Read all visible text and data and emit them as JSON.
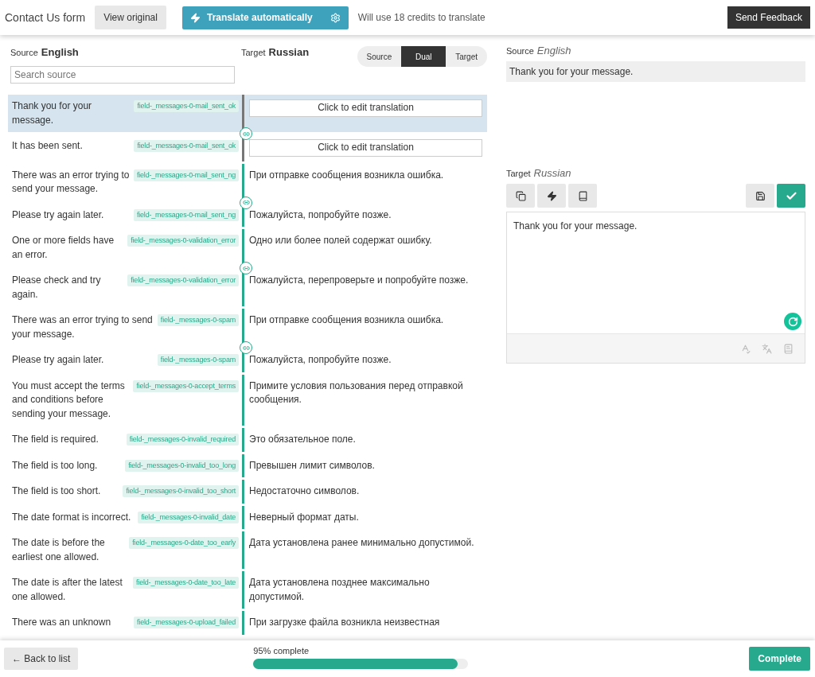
{
  "header": {
    "title": "Contact Us form",
    "view_original": "View original",
    "translate_button": "Translate automatically",
    "credits_note": "Will use 18 credits to translate",
    "feedback_button": "Send Feedback"
  },
  "list_header": {
    "source_label": "Source",
    "source_lang": "English",
    "target_label": "Target",
    "target_lang": "Russian",
    "search": {
      "placeholder": "Search source"
    },
    "modes": [
      {
        "label": "Source",
        "selected": false
      },
      {
        "label": "Dual",
        "selected": true
      },
      {
        "label": "Target",
        "selected": false
      }
    ]
  },
  "rows": [
    {
      "source": "Thank you for your message.",
      "key": "field-_messages-0-mail_sent_ok",
      "kind": "untranslated",
      "target": "Click to edit translation",
      "selected": true,
      "linked": true
    },
    {
      "source": "It has been sent.",
      "key": "field-_messages-0-mail_sent_ok",
      "kind": "untranslated",
      "target": "Click to edit translation",
      "selected": false,
      "linked": false
    },
    {
      "source": "There was an error trying to send your message.",
      "key": "field-_messages-0-mail_sent_ng",
      "kind": "translated",
      "target": "При отправке сообщения возникла ошибка.",
      "selected": false,
      "linked": true
    },
    {
      "source": "Please try again later.",
      "key": "field-_messages-0-mail_sent_ng",
      "kind": "translated",
      "target": "Пожалуйста, попробуйте позже.",
      "selected": false,
      "linked": false
    },
    {
      "source": "One or more fields have an error.",
      "key": "field-_messages-0-validation_error",
      "kind": "translated",
      "target": "Одно или более полей содержат ошибку.",
      "selected": false,
      "linked": true
    },
    {
      "source": "Please check and try again.",
      "key": "field-_messages-0-validation_error",
      "kind": "translated",
      "target": "Пожалуйста, перепроверьте и попробуйте позже.",
      "selected": false,
      "linked": false
    },
    {
      "source": "There was an error trying to send your message.",
      "key": "field-_messages-0-spam",
      "kind": "translated",
      "target": "При отправке сообщения возникла ошибка.",
      "selected": false,
      "linked": true
    },
    {
      "source": "Please try again later.",
      "key": "field-_messages-0-spam",
      "kind": "translated",
      "target": "Пожалуйста, попробуйте позже.",
      "selected": false,
      "linked": false
    },
    {
      "source": "You must accept the terms and conditions before sending your message.",
      "key": "field-_messages-0-accept_terms",
      "kind": "translated",
      "target": "Примите условия пользования перед отправкой сообщения.",
      "selected": false,
      "linked": false
    },
    {
      "source": "The field is required.",
      "key": "field-_messages-0-invalid_required",
      "kind": "translated",
      "target": "Это обязательное поле.",
      "selected": false,
      "linked": false
    },
    {
      "source": "The field is too long.",
      "key": "field-_messages-0-invalid_too_long",
      "kind": "translated",
      "target": "Превышен лимит символов.",
      "selected": false,
      "linked": false
    },
    {
      "source": "The field is too short.",
      "key": "field-_messages-0-invalid_too_short",
      "kind": "translated",
      "target": "Недостаточно символов.",
      "selected": false,
      "linked": false
    },
    {
      "source": "The date format is incorrect.",
      "key": "field-_messages-0-invalid_date",
      "kind": "translated",
      "target": "Неверный формат даты.",
      "selected": false,
      "linked": false
    },
    {
      "source": "The date is before the earliest one allowed.",
      "key": "field-_messages-0-date_too_early",
      "kind": "translated",
      "target": "Дата установлена ранее минимально допустимой.",
      "selected": false,
      "linked": false
    },
    {
      "source": "The date is after the latest one allowed.",
      "key": "field-_messages-0-date_too_late",
      "kind": "translated",
      "target": "Дата установлена позднее максимально допустимой.",
      "selected": false,
      "linked": false
    },
    {
      "source": "There was an unknown",
      "key": "field-_messages-0-upload_failed",
      "kind": "translated",
      "target": "При загрузке файла возникла неизвестная",
      "selected": false,
      "linked": false
    }
  ],
  "editor": {
    "source_label": "Source",
    "source_lang": "English",
    "source_text": "Thank you for your message.",
    "target_label": "Target",
    "target_lang": "Russian",
    "target_text": "Thank you for your message."
  },
  "footer": {
    "back_button": "← Back to list",
    "progress": {
      "label": "95% complete",
      "level": 0.95
    },
    "complete_button": "Complete"
  }
}
